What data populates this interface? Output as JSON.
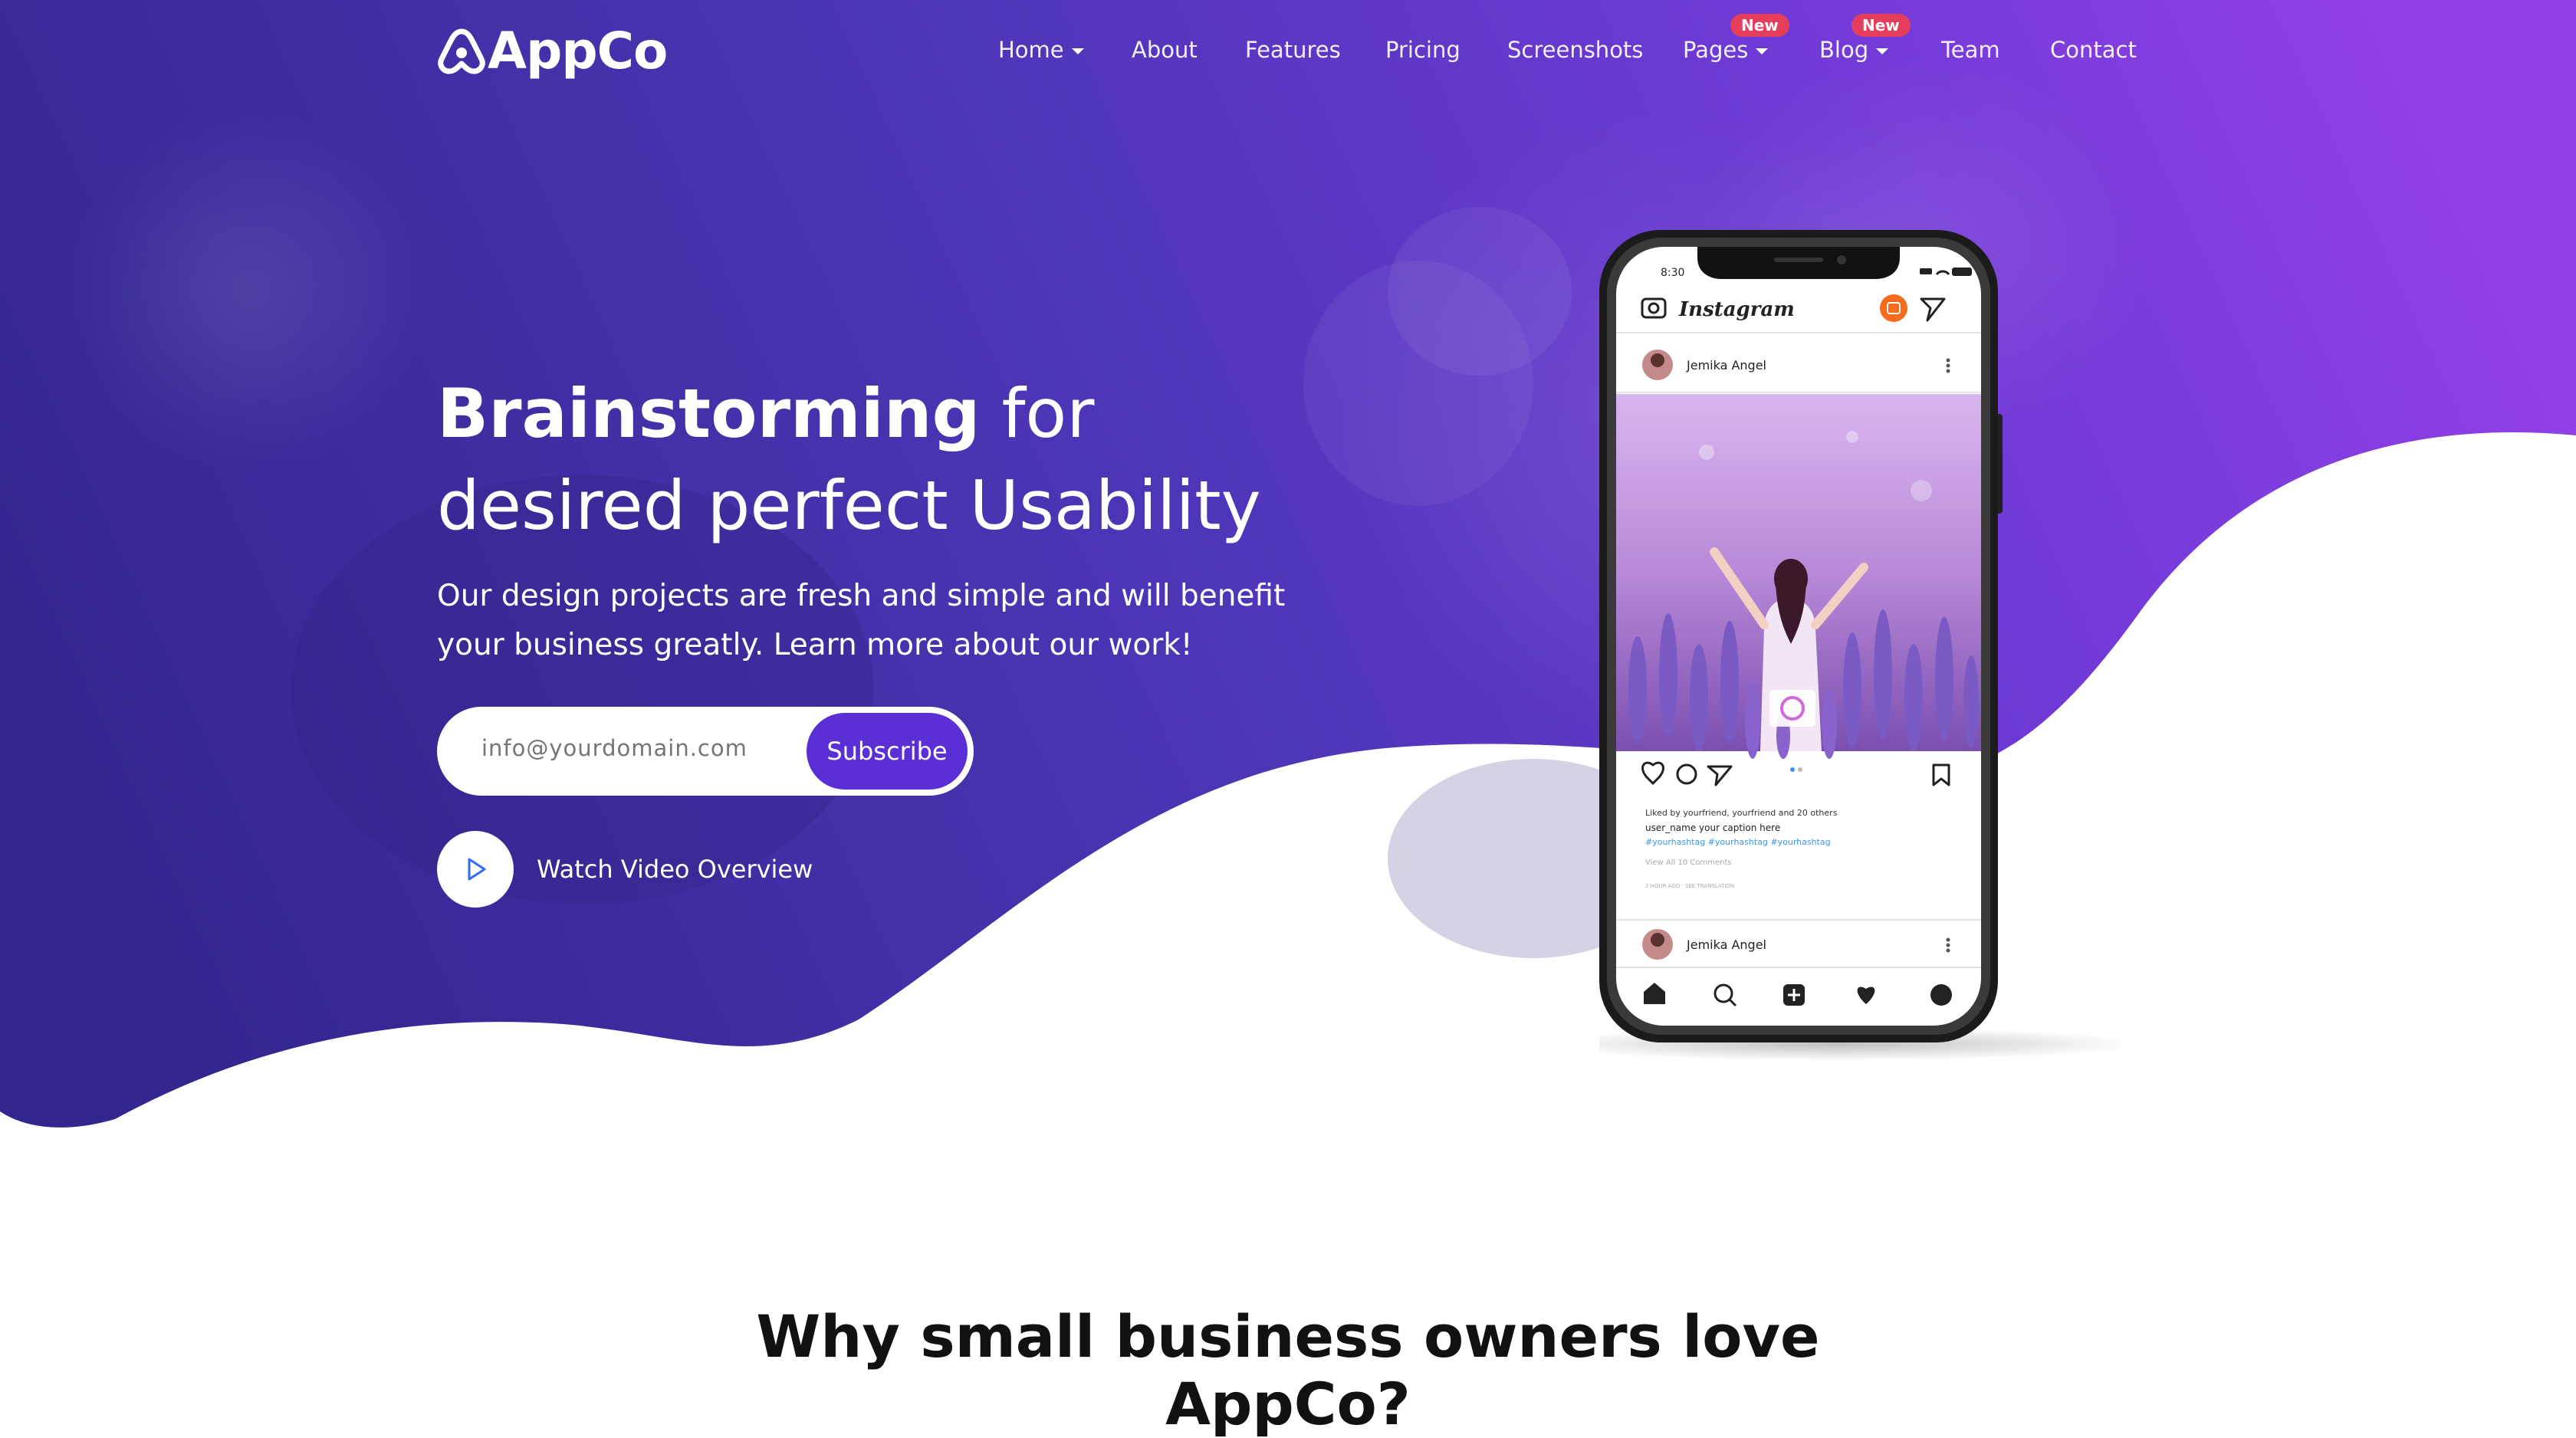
{
  "brand": {
    "name": "AppCo"
  },
  "nav": {
    "items": [
      {
        "label": "Home",
        "dropdown": true
      },
      {
        "label": "About"
      },
      {
        "label": "Features"
      },
      {
        "label": "Pricing"
      },
      {
        "label": "Screenshots"
      },
      {
        "label": "Pages",
        "dropdown": true,
        "badge": "New"
      },
      {
        "label": "Blog",
        "dropdown": true,
        "badge": "New"
      },
      {
        "label": "Team"
      },
      {
        "label": "Contact"
      }
    ]
  },
  "hero": {
    "headline_bold": "Brainstorming",
    "headline_rest_1": " for",
    "headline_line2": "desired perfect Usability",
    "lead": "Our design projects are fresh and simple and will benefit your business greatly. Learn more about our work!",
    "email_placeholder": "info@yourdomain.com",
    "subscribe_label": "Subscribe",
    "video_label": "Watch Video Overview"
  },
  "phone": {
    "status_time": "8:30",
    "app_name": "Instagram",
    "post_user": "Jemika Angel",
    "likes_text": "Liked by yourfriend, yourfriend and 20 others",
    "caption": "user_name  your caption here",
    "hashtags": "#yourhashtag #yourhashtag #yourhashtag",
    "comments": "View All 10 Comments",
    "time_ago": "2 HOUR AGO  ·  SEE TRANSLATION",
    "second_user": "Jemika Angel"
  },
  "section": {
    "title_line1": "Why small business owners love",
    "title_line2": "AppCo?"
  },
  "colors": {
    "hero_gradient_start": "#3a2a9a",
    "hero_gradient_end": "#8a3ce0",
    "button": "#5b2fd6",
    "badge": "#e53e5c",
    "play_icon": "#2f6bff"
  }
}
